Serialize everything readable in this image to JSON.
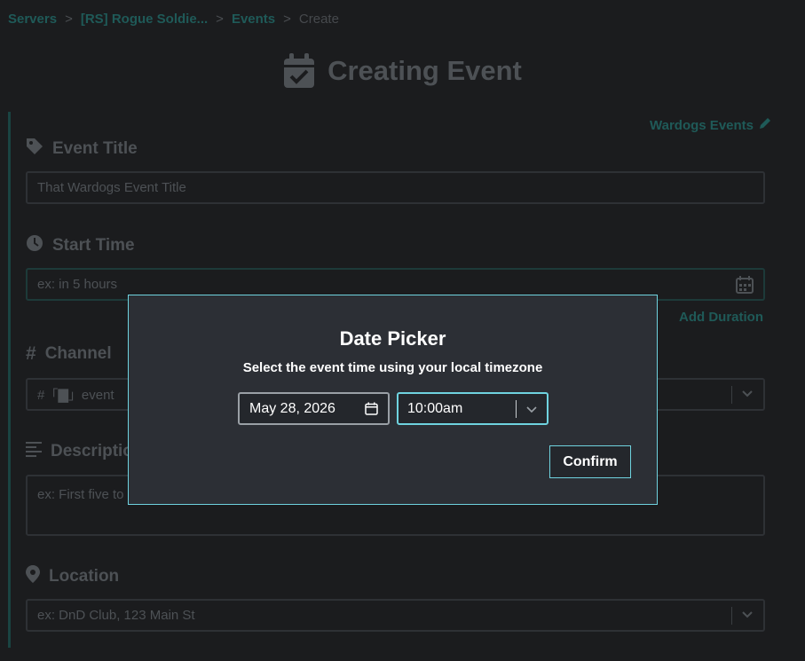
{
  "breadcrumb": {
    "items": [
      "Servers",
      "[RS] Rogue Soldie...",
      "Events"
    ],
    "current": "Create",
    "separator": ">"
  },
  "page": {
    "title": "Creating Event",
    "server_tag": "Wardogs Events"
  },
  "form": {
    "event_title": {
      "label": "Event Title",
      "value": "That Wardogs Event Title"
    },
    "start_time": {
      "label": "Start Time",
      "placeholder": "ex: in 5 hours",
      "add_duration": "Add Duration"
    },
    "channel": {
      "label": "Channel",
      "value": "#「▇」event"
    },
    "description": {
      "label": "Descriptio",
      "placeholder": "ex: First five to"
    },
    "location": {
      "label": "Location",
      "placeholder": "ex: DnD Club, 123 Main St"
    }
  },
  "modal": {
    "title": "Date Picker",
    "subtitle": "Select the event time using your local timezone",
    "date_value": "May 28, 2026",
    "time_value": "10:00am",
    "confirm_label": "Confirm"
  },
  "colors": {
    "accent": "#6fd3df",
    "modal_bg": "#2c2f35",
    "page_bg": "#1b1c1e"
  }
}
